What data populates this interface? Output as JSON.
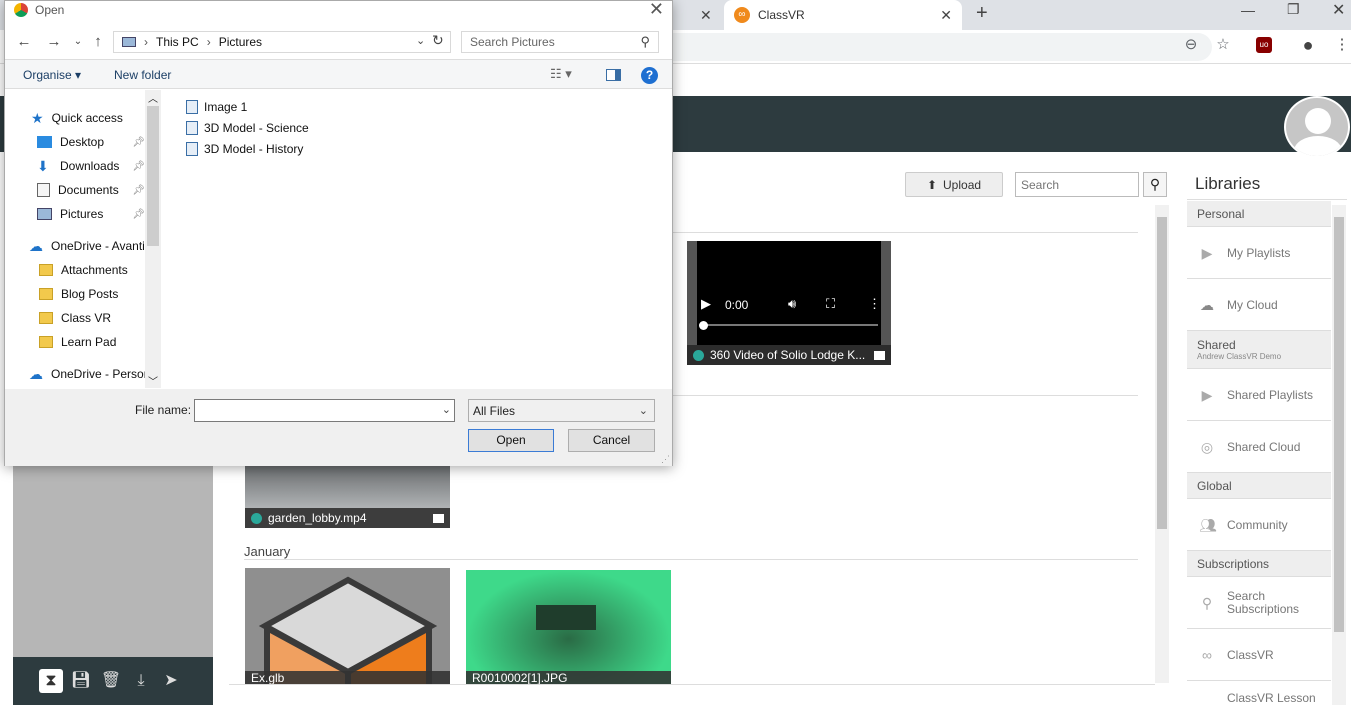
{
  "browser": {
    "tabs": [
      {
        "title": ""
      },
      {
        "title": "ClassVR"
      }
    ],
    "new_tab": "+"
  },
  "app": {
    "upload_label": "Upload",
    "search_placeholder": "Search",
    "media": [
      {
        "caption": "360 Video of Solio Lodge K...",
        "time": "0:00"
      },
      {
        "caption": "garden_lobby.mp4"
      },
      {
        "caption": "Ex.glb"
      },
      {
        "caption": "R0010002[1].JPG"
      }
    ],
    "section_january": "January"
  },
  "libraries": {
    "title": "Libraries",
    "sections": {
      "personal": "Personal",
      "shared": "Shared",
      "shared_sub": "Andrew ClassVR Demo",
      "global": "Global",
      "subscriptions": "Subscriptions"
    },
    "items": {
      "my_playlists": "My Playlists",
      "my_cloud": "My Cloud",
      "shared_playlists": "Shared Playlists",
      "shared_cloud": "Shared Cloud",
      "community": "Community",
      "search_subs_1": "Search",
      "search_subs_2": "Subscriptions",
      "classvr": "ClassVR",
      "classvr_lesson": "ClassVR Lesson"
    }
  },
  "dialog": {
    "title": "Open",
    "path": [
      "This PC",
      "Pictures"
    ],
    "search_placeholder": "Search Pictures",
    "organise": "Organise",
    "new_folder": "New folder",
    "nav": {
      "quick_access": "Quick access",
      "desktop": "Desktop",
      "downloads": "Downloads",
      "documents": "Documents",
      "pictures": "Pictures",
      "onedrive_avanti": "OneDrive - Avanti",
      "attachments": "Attachments",
      "blog_posts": "Blog Posts",
      "class_vr": "Class VR",
      "learn_pad": "Learn Pad",
      "onedrive_personal": "OneDrive - Persor"
    },
    "files": [
      "Image 1",
      "3D Model - Science",
      "3D Model - History"
    ],
    "file_name_label": "File name:",
    "file_name_value": "",
    "file_type": "All Files",
    "open_label": "Open",
    "cancel_label": "Cancel"
  }
}
